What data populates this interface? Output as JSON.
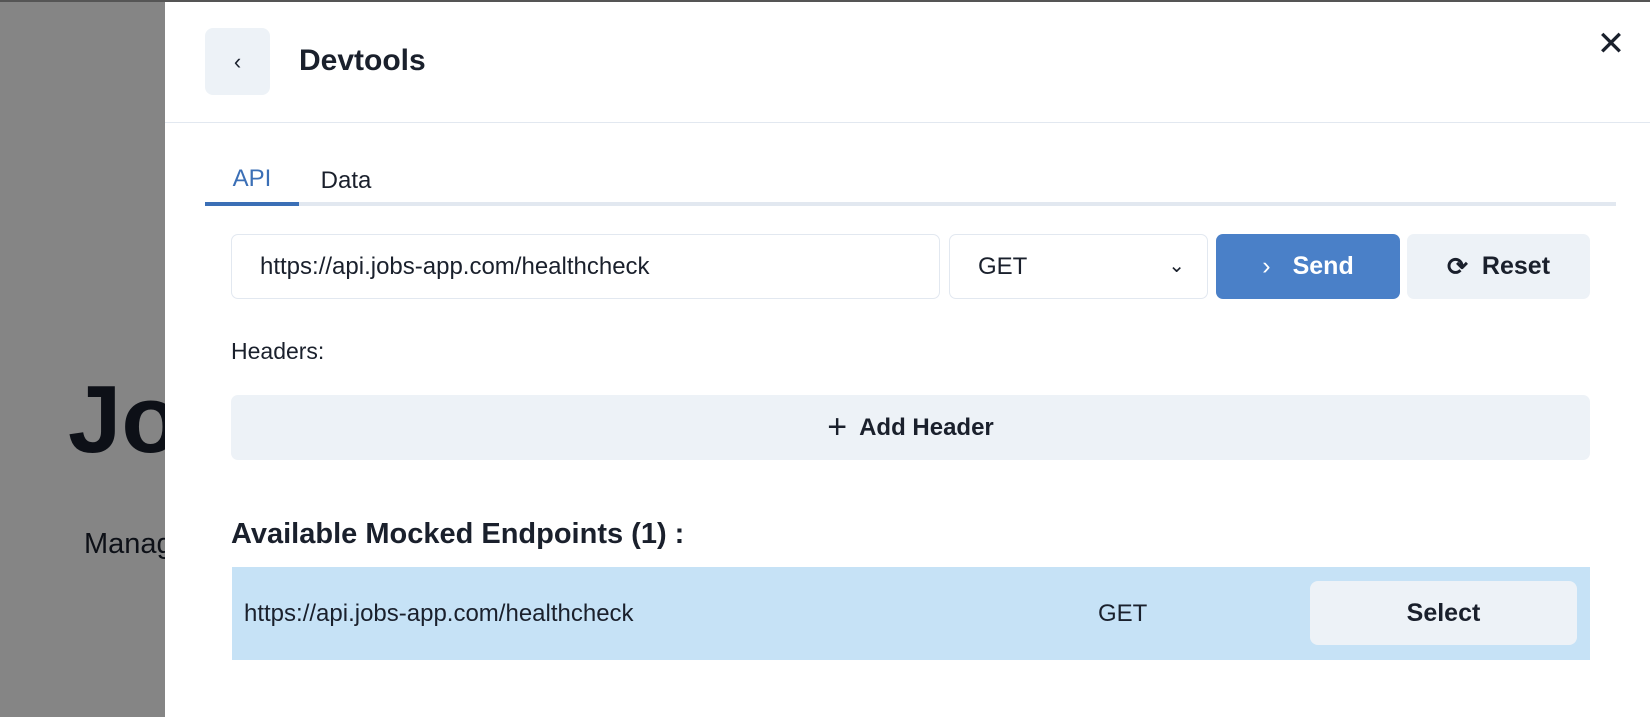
{
  "background": {
    "title": "Jobs",
    "subtitle": "Manage"
  },
  "drawer": {
    "back_icon": "chevron-left-icon",
    "title": "Devtools",
    "close_icon": "close-icon",
    "tabs": [
      {
        "label": "API",
        "active": true
      },
      {
        "label": "Data",
        "active": false
      }
    ],
    "request": {
      "url_value": "https://api.jobs-app.com/healthcheck",
      "method": "GET",
      "send_label": "Send",
      "reset_label": "Reset"
    },
    "headers_label": "Headers:",
    "add_header_label": "Add Header",
    "endpoints_heading": "Available Mocked Endpoints (1) :",
    "endpoints": [
      {
        "url": "https://api.jobs-app.com/healthcheck",
        "method": "GET",
        "action": "Select"
      }
    ]
  },
  "colors": {
    "accent": "#4a80c8",
    "selected_row": "#c6e2f6",
    "button_bg": "#edf2f7"
  }
}
